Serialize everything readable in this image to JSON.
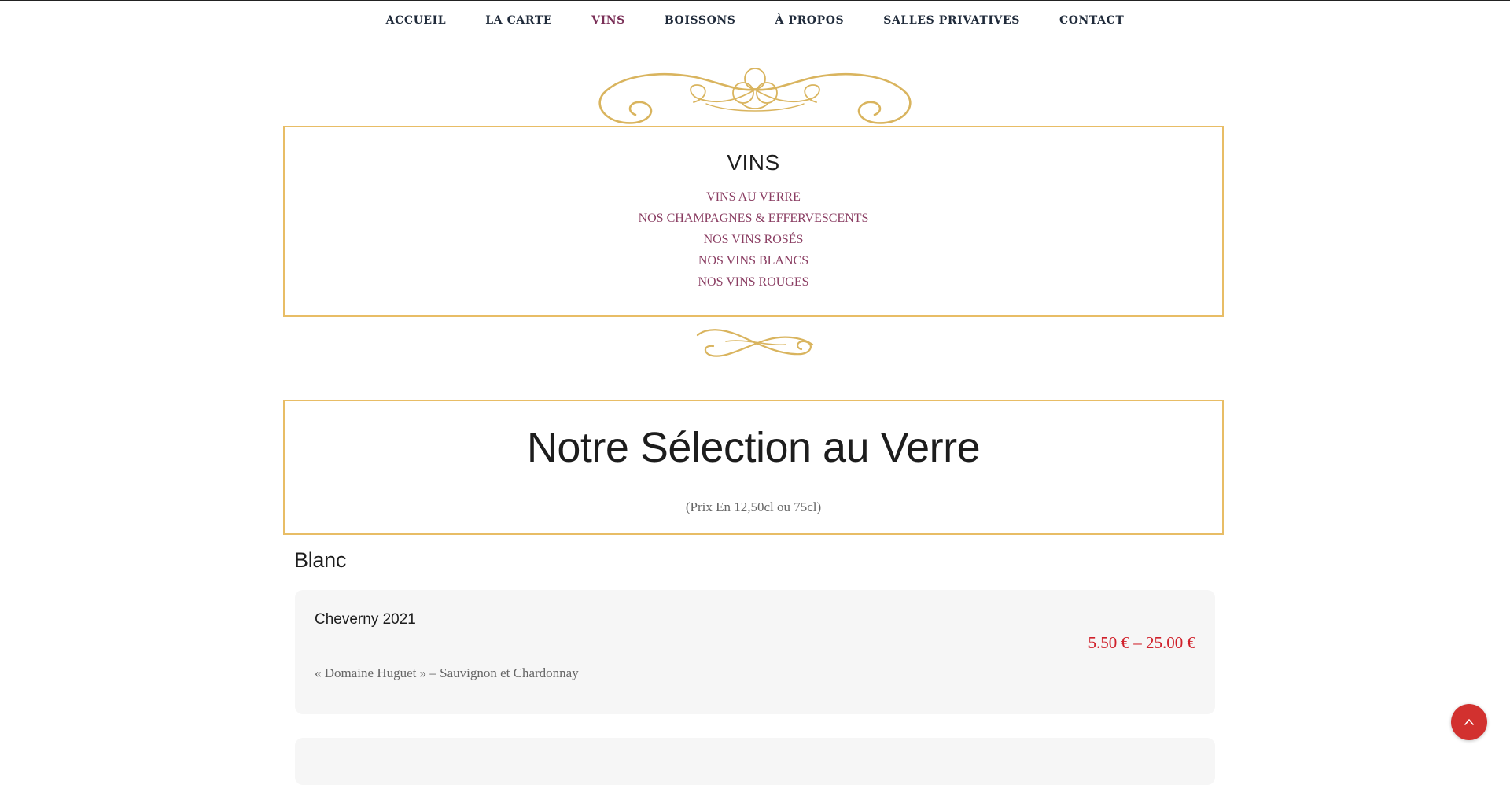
{
  "nav": {
    "items": [
      {
        "label": "ACCUEIL"
      },
      {
        "label": "LA CARTE"
      },
      {
        "label": "VINS"
      },
      {
        "label": "BOISSONS"
      },
      {
        "label": "À PROPOS"
      },
      {
        "label": "SALLES PRIVATIVES"
      },
      {
        "label": "CONTACT"
      }
    ],
    "active": "VINS"
  },
  "vins_panel": {
    "title": "VINS",
    "links": [
      "VINS AU VERRE",
      "NOS CHAMPAGNES & EFFERVESCENTS",
      "NOS VINS ROSÉS",
      "NOS VINS BLANCS",
      "NOS VINS ROUGES"
    ]
  },
  "selection": {
    "title": "Notre Sélection au Verre",
    "subtitle": "(Prix En 12,50cl ou 75cl)"
  },
  "category": "Blanc",
  "wines": [
    {
      "name": "Cheverny 2021",
      "price": "5.50 € – 25.00 €",
      "description": "« Domaine Huguet »  – Sauvignon et Chardonnay"
    }
  ],
  "colors": {
    "gold": "#e8bd66",
    "link": "#8a3d62",
    "price": "#d0212b",
    "nav_active": "#7a2f57",
    "back_to_top": "#d2312f"
  },
  "icons": {
    "back_to_top": "chevron-up-icon"
  }
}
